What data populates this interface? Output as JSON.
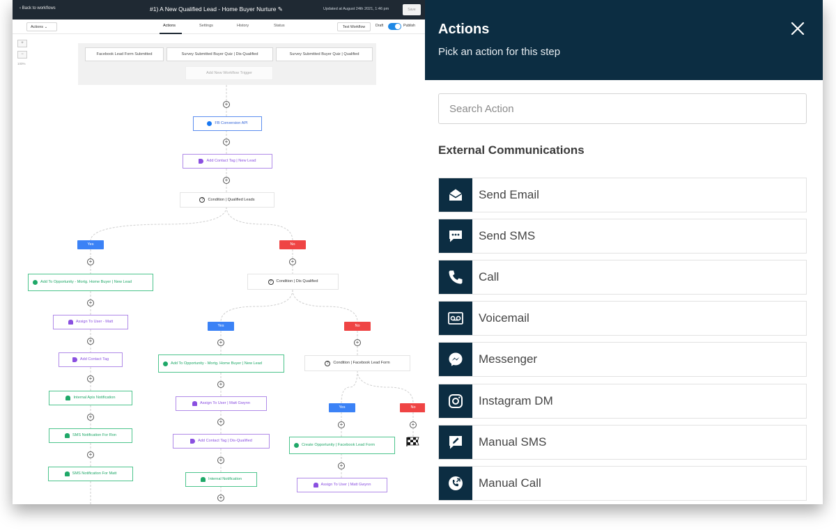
{
  "topbar": {
    "back": "‹ Back to workflows",
    "title": "#1) A New Qualified Lead - Home Buyer Nurture",
    "updated": "Updated at August 24th 2021, 1:46 pm",
    "save": "Save"
  },
  "subbar": {
    "actions_dropdown": "Actions",
    "tabs": [
      "Actions",
      "Settings",
      "History",
      "Status"
    ],
    "test_workflow": "Test Workflow",
    "draft": "Draft",
    "publish": "Publish"
  },
  "zoom": {
    "plus": "+",
    "minus": "−",
    "percent": "100%"
  },
  "triggers": [
    "Facebook Lead Form Submitted",
    "Survey Submitted Buyer Quiz | Dis-Qualified",
    "Survey Submitted Buyer Quiz | Qualified"
  ],
  "add_trigger": "Add New Workflow Trigger",
  "nodes": {
    "fb_api": "FB Conversion API",
    "tag_new_lead": "Add Contact Tag | New Lead",
    "cond_qualified": "Condition | Qualified Leads",
    "yes_opp": "Add To Opportunity - Mortg. Home Buyer | New Lead",
    "assign_matt": "Assign To User - Matt",
    "add_tag": "Add Contact Tag",
    "internal_apis": "Internal Apis Notification",
    "sms_ron": "SMS Notification For Ron",
    "sms_matt": "SMS Notification For Matt",
    "cond_dis": "Condition | Dis Qualified",
    "opp2": "Add To Opportunity - Mortg. Home Buyer | New Lead",
    "assign_gwynn": "Assign To User | Matt Gwynn",
    "tag_dis": "Add Contact Tag | Dis-Qualified",
    "internal_notif": "Internal Notification",
    "cond_fb": "Condition | Facebook Lead Form",
    "create_opp": "Create Opportunity | Facebook Lead Form",
    "assign_gwynn2": "Assign To User | Matt Gwynn"
  },
  "branches": {
    "yes": "Yes",
    "no": "No"
  },
  "panel": {
    "title": "Actions",
    "subtitle": "Pick an action for this step",
    "search_placeholder": "Search Action",
    "section": "External Communications",
    "actions": [
      {
        "label": "Send Email",
        "icon": "envelope-open-icon"
      },
      {
        "label": "Send SMS",
        "icon": "chat-bubble-icon"
      },
      {
        "label": "Call",
        "icon": "phone-icon"
      },
      {
        "label": "Voicemail",
        "icon": "voicemail-icon"
      },
      {
        "label": "Messenger",
        "icon": "messenger-icon"
      },
      {
        "label": "Instagram DM",
        "icon": "instagram-icon"
      },
      {
        "label": "Manual SMS",
        "icon": "pencil-message-icon"
      },
      {
        "label": "Manual Call",
        "icon": "manual-call-icon"
      }
    ]
  },
  "colors": {
    "panel_header": "#0c2d42",
    "topbar": "#1f2933",
    "yes_badge": "#3b82f6",
    "no_badge": "#ef4444",
    "action_node_blue": "#3466d8",
    "tag_node_purple": "#8a4fe0",
    "notification_green": "#1fa868"
  }
}
